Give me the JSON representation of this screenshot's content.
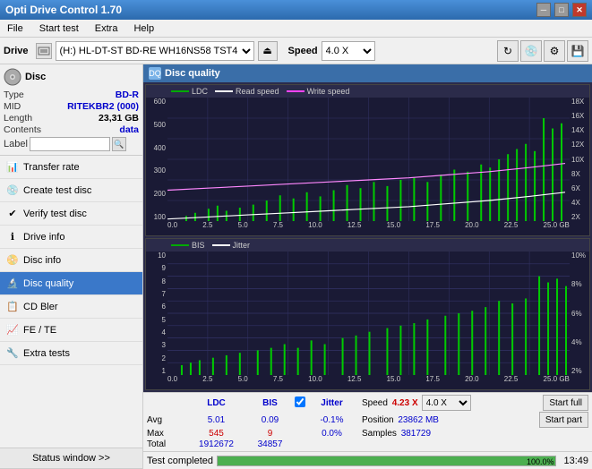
{
  "app": {
    "title": "Opti Drive Control 1.70",
    "titlebar_controls": [
      "minimize",
      "maximize",
      "close"
    ]
  },
  "menu": {
    "items": [
      "File",
      "Start test",
      "Extra",
      "Help"
    ]
  },
  "drivebar": {
    "label": "Drive",
    "drive_value": "(H:)  HL-DT-ST BD-RE  WH16NS58 TST4",
    "speed_label": "Speed",
    "speed_value": "4.0 X"
  },
  "disc_panel": {
    "header": "Disc",
    "type_label": "Type",
    "type_value": "BD-R",
    "mid_label": "MID",
    "mid_value": "RITEKBR2 (000)",
    "length_label": "Length",
    "length_value": "23,31 GB",
    "contents_label": "Contents",
    "contents_value": "data",
    "label_label": "Label",
    "label_value": ""
  },
  "nav": {
    "items": [
      {
        "id": "transfer-rate",
        "label": "Transfer rate",
        "icon": "📊"
      },
      {
        "id": "create-test-disc",
        "label": "Create test disc",
        "icon": "💿"
      },
      {
        "id": "verify-test-disc",
        "label": "Verify test disc",
        "icon": "✔"
      },
      {
        "id": "drive-info",
        "label": "Drive info",
        "icon": "ℹ"
      },
      {
        "id": "disc-info",
        "label": "Disc info",
        "icon": "📀"
      },
      {
        "id": "disc-quality",
        "label": "Disc quality",
        "icon": "🔬",
        "active": true
      },
      {
        "id": "cd-bler",
        "label": "CD Bler",
        "icon": "📋"
      },
      {
        "id": "fe-te",
        "label": "FE / TE",
        "icon": "📈"
      },
      {
        "id": "extra-tests",
        "label": "Extra tests",
        "icon": "🔧"
      }
    ],
    "status_window": "Status window >>"
  },
  "disc_quality": {
    "title": "Disc quality",
    "chart1": {
      "legend": [
        {
          "label": "LDC",
          "color": "#00aa00"
        },
        {
          "label": "Read speed",
          "color": "#ffffff"
        },
        {
          "label": "Write speed",
          "color": "#ff44ff"
        }
      ],
      "y_axis_left": [
        "600",
        "500",
        "400",
        "300",
        "200",
        "100",
        "0.0"
      ],
      "y_axis_right": [
        "18X",
        "16X",
        "14X",
        "12X",
        "10X",
        "8X",
        "6X",
        "4X",
        "2X"
      ],
      "x_axis": [
        "0.0",
        "2.5",
        "5.0",
        "7.5",
        "10.0",
        "12.5",
        "15.0",
        "17.5",
        "20.0",
        "22.5",
        "25.0 GB"
      ]
    },
    "chart2": {
      "legend": [
        {
          "label": "BIS",
          "color": "#00aa00"
        },
        {
          "label": "Jitter",
          "color": "#ffffff"
        }
      ],
      "y_axis_left": [
        "10",
        "9",
        "8",
        "7",
        "6",
        "5",
        "4",
        "3",
        "2",
        "1"
      ],
      "y_axis_right": [
        "10%",
        "8%",
        "6%",
        "4%",
        "2%"
      ],
      "x_axis": [
        "0.0",
        "2.5",
        "5.0",
        "7.5",
        "10.0",
        "12.5",
        "15.0",
        "17.5",
        "20.0",
        "22.5",
        "25.0 GB"
      ]
    }
  },
  "stats": {
    "headers": [
      "LDC",
      "BIS",
      "Jitter",
      "Speed"
    ],
    "jitter_checked": true,
    "speed_display": "4.23 X",
    "speed_select": "4.0 X",
    "avg_label": "Avg",
    "avg_ldc": "5.01",
    "avg_bis": "0.09",
    "avg_jitter": "-0.1%",
    "max_label": "Max",
    "max_ldc": "545",
    "max_bis": "9",
    "max_jitter": "0.0%",
    "total_label": "Total",
    "total_ldc": "1912672",
    "total_bis": "34857",
    "total_jitter": "",
    "position_label": "Position",
    "position_value": "23862 MB",
    "samples_label": "Samples",
    "samples_value": "381729",
    "start_full_label": "Start full",
    "start_part_label": "Start part"
  },
  "progress": {
    "label": "Test completed",
    "percent": 100,
    "percent_display": "100.0%",
    "time": "13:49"
  }
}
